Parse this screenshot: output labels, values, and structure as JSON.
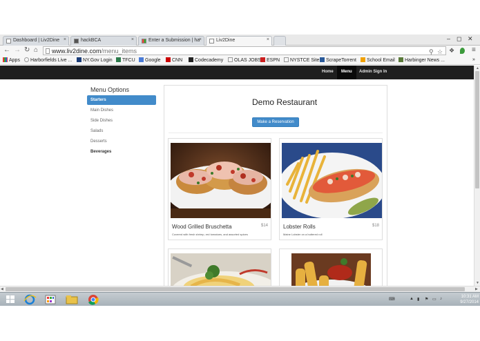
{
  "browser": {
    "tabs": [
      {
        "title": "Dashboard | Liv2Dine"
      },
      {
        "title": "hackBCA"
      },
      {
        "title": "Enter a Submission | ha"
      },
      {
        "title": "Liv2Dine"
      }
    ],
    "close_glyph": "×",
    "window_controls": {
      "minimize": "–",
      "maximize": "◻",
      "close": "✕"
    },
    "url_host": "www.liv2dine.com",
    "url_path": "/menu_items",
    "bookmarks": [
      "Apps",
      "Harborfields Live ...",
      "NY.Gov Login",
      "TFCU",
      "Google",
      "CNN",
      "Codecademy",
      "OLAS JOBS",
      "ESPN",
      "NYSTCE Site",
      "ScrapeTorrent",
      "School Email",
      "Harbinger News ..."
    ],
    "overflow_glyph": "»"
  },
  "site_nav": {
    "home": "Home",
    "menu": "Menu",
    "admin": "Admin Sign In"
  },
  "sidebar": {
    "heading": "Menu Options",
    "items": [
      "Starters",
      "Main Dishes",
      "Side Dishes",
      "Salads",
      "Desserts",
      "Beverages"
    ],
    "active_index": 0
  },
  "restaurant": {
    "name": "Demo Restaurant",
    "reserve_button": "Make a Reservation"
  },
  "dishes": [
    {
      "name": "Wood Grilled Bruschetta",
      "price": "$14",
      "description": "Covered with fresh shrimp, red tomatoes, and assorted spices"
    },
    {
      "name": "Lobster Rolls",
      "price": "$18",
      "description": "Maine Lobster on a buttered roll"
    }
  ],
  "taskbar": {
    "time": "10:31 AM",
    "date": "9/27/2014"
  },
  "colors": {
    "accent": "#428bca",
    "nav_bg": "#1f1f1f"
  }
}
